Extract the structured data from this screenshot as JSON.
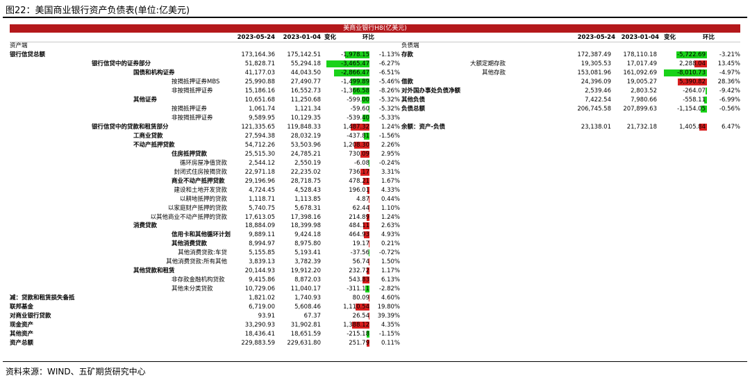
{
  "figure_title": "图22：美国商业银行资产负债表(单位:亿美元)",
  "banner": "美商业银行H8(亿美元)",
  "source": "资料来源：WIND、五矿期货研究中心",
  "colors": {
    "banner": "#b4181b",
    "neg_bar": "#19d219",
    "pos_bar": "#d91f1f"
  },
  "left": {
    "section": "资产端",
    "headers": {
      "d1": "2023-05-24",
      "d2": "2023-01-04",
      "chg": "变化",
      "pct": "环比"
    },
    "max_abs_change": 3465.47,
    "rows": [
      {
        "label": "银行信贷总额",
        "indent": 0,
        "bold": true,
        "d1": "173,164.36",
        "d2": "175,142.51",
        "chg": "-1,978.15",
        "cv": -1978.15,
        "pct": "-1.13%"
      },
      {
        "label": "银行信贷中的证券部分",
        "indent": 1,
        "bold": true,
        "d1": "51,828.71",
        "d2": "55,294.18",
        "chg": "-3,465.47",
        "cv": -3465.47,
        "pct": "-6.27%"
      },
      {
        "label": "国债和机构证券",
        "indent": 2,
        "bold": true,
        "d1": "41,177.03",
        "d2": "44,043.50",
        "chg": "-2,866.47",
        "cv": -2866.47,
        "pct": "-6.51%"
      },
      {
        "label": "按揭抵押证券MBS",
        "indent": 3,
        "bold": false,
        "d1": "25,990.88",
        "d2": "27,490.77",
        "chg": "-1,499.89",
        "cv": -1499.89,
        "pct": "-5.46%"
      },
      {
        "label": "非按揭抵押证券",
        "indent": 3,
        "bold": false,
        "d1": "15,186.16",
        "d2": "16,552.73",
        "chg": "-1,366.58",
        "cv": -1366.58,
        "pct": "-8.26%"
      },
      {
        "label": "其他证券",
        "indent": 2,
        "bold": true,
        "d1": "10,651.68",
        "d2": "11,250.68",
        "chg": "-599.00",
        "cv": -599.0,
        "pct": "-5.32%"
      },
      {
        "label": "按揭抵押证券",
        "indent": 3,
        "bold": false,
        "d1": "1,061.74",
        "d2": "1,121.34",
        "chg": "-59.60",
        "cv": -59.6,
        "pct": "-5.32%"
      },
      {
        "label": "非按揭抵押证券",
        "indent": 3,
        "bold": false,
        "d1": "9,589.95",
        "d2": "10,129.35",
        "chg": "-539.40",
        "cv": -539.4,
        "pct": "-5.33%"
      },
      {
        "label": "银行信贷中的贷款和租赁部分",
        "indent": 1,
        "bold": true,
        "d1": "121,335.65",
        "d2": "119,848.33",
        "chg": "1,487.32",
        "cv": 1487.32,
        "pct": "1.24%"
      },
      {
        "label": "工商业贷款",
        "indent": 2,
        "bold": true,
        "d1": "27,594.38",
        "d2": "28,032.19",
        "chg": "-437.81",
        "cv": -437.81,
        "pct": "-1.56%"
      },
      {
        "label": "不动产抵押贷款",
        "indent": 2,
        "bold": true,
        "d1": "54,712.26",
        "d2": "53,503.96",
        "chg": "1,208.30",
        "cv": 1208.3,
        "pct": "2.26%"
      },
      {
        "label": "住房抵押贷款",
        "indent": 3,
        "bold": true,
        "d1": "25,515.30",
        "d2": "24,785.21",
        "chg": "730.09",
        "cv": 730.09,
        "pct": "2.95%"
      },
      {
        "label": "循环房屋净值贷款",
        "indent": 4,
        "bold": false,
        "d1": "2,544.12",
        "d2": "2,550.19",
        "chg": "-6.08",
        "cv": -6.08,
        "pct": "-0.24%"
      },
      {
        "label": "封闭式住房按揭贷款",
        "indent": 4,
        "bold": false,
        "d1": "22,971.18",
        "d2": "22,235.02",
        "chg": "736.17",
        "cv": 736.17,
        "pct": "3.31%"
      },
      {
        "label": "商业不动产抵押贷款",
        "indent": 3,
        "bold": true,
        "d1": "29,196.96",
        "d2": "28,718.75",
        "chg": "478.21",
        "cv": 478.21,
        "pct": "1.67%"
      },
      {
        "label": "建设和土地开发贷款",
        "indent": 4,
        "bold": false,
        "d1": "4,724.45",
        "d2": "4,528.43",
        "chg": "196.01",
        "cv": 196.01,
        "pct": "4.33%"
      },
      {
        "label": "以耕地抵押的贷款",
        "indent": 4,
        "bold": false,
        "d1": "1,118.71",
        "d2": "1,113.85",
        "chg": "4.87",
        "cv": 4.87,
        "pct": "0.44%"
      },
      {
        "label": "以家庭财产抵押的贷款",
        "indent": 4,
        "bold": false,
        "d1": "5,740.75",
        "d2": "5,678.31",
        "chg": "62.44",
        "cv": 62.44,
        "pct": "1.10%"
      },
      {
        "label": "以其他商业不动产抵押的贷款",
        "indent": 4,
        "bold": false,
        "d1": "17,613.05",
        "d2": "17,398.16",
        "chg": "214.89",
        "cv": 214.89,
        "pct": "1.24%"
      },
      {
        "label": "消费贷款",
        "indent": 2,
        "bold": true,
        "d1": "18,884.09",
        "d2": "18,399.98",
        "chg": "484.11",
        "cv": 484.11,
        "pct": "2.63%"
      },
      {
        "label": "信用卡和其他循环计划",
        "indent": 3,
        "bold": true,
        "d1": "9,889.11",
        "d2": "9,424.18",
        "chg": "464.93",
        "cv": 464.93,
        "pct": "4.93%"
      },
      {
        "label": "其他消费贷款",
        "indent": 3,
        "bold": true,
        "d1": "8,994.97",
        "d2": "8,975.80",
        "chg": "19.17",
        "cv": 19.17,
        "pct": "0.21%"
      },
      {
        "label": "其他消费贷款:车贷",
        "indent": 4,
        "bold": false,
        "d1": "5,155.85",
        "d2": "5,193.41",
        "chg": "-37.56",
        "cv": -37.56,
        "pct": "-0.72%"
      },
      {
        "label": "其他消费贷款:所有其他",
        "indent": 4,
        "bold": false,
        "d1": "3,839.13",
        "d2": "3,782.39",
        "chg": "56.74",
        "cv": 56.74,
        "pct": "1.50%"
      },
      {
        "label": "其他贷款和租赁",
        "indent": 2,
        "bold": true,
        "d1": "20,144.93",
        "d2": "19,912.20",
        "chg": "232.72",
        "cv": 232.72,
        "pct": "1.17%"
      },
      {
        "label": "非存款金融机构贷款",
        "indent": 3,
        "bold": false,
        "d1": "9,415.86",
        "d2": "8,872.03",
        "chg": "543.83",
        "cv": 543.83,
        "pct": "6.13%"
      },
      {
        "label": "其他未分类贷款",
        "indent": 3,
        "bold": false,
        "d1": "10,729.06",
        "d2": "11,040.17",
        "chg": "-311.11",
        "cv": -311.11,
        "pct": "-2.82%"
      },
      {
        "label": "减：贷款和租赁损失备抵",
        "indent": 0,
        "bold": true,
        "d1": "1,821.02",
        "d2": "1,740.93",
        "chg": "80.09",
        "cv": 80.09,
        "pct": "4.60%"
      },
      {
        "label": "联邦基金",
        "indent": 0,
        "bold": true,
        "d1": "6,719.00",
        "d2": "5,608.46",
        "chg": "1,110.54",
        "cv": 1110.54,
        "pct": "19.80%"
      },
      {
        "label": "对商业银行贷款",
        "indent": 0,
        "bold": true,
        "d1": "93.91",
        "d2": "67.37",
        "chg": "26.54",
        "cv": 26.54,
        "pct": "39.39%"
      },
      {
        "label": "现金资产",
        "indent": 0,
        "bold": true,
        "d1": "33,290.93",
        "d2": "31,902.81",
        "chg": "1,388.12",
        "cv": 1388.12,
        "pct": "4.35%"
      },
      {
        "label": "其他资产",
        "indent": 0,
        "bold": true,
        "d1": "18,436.41",
        "d2": "18,651.59",
        "chg": "-215.18",
        "cv": -215.18,
        "pct": "-1.15%"
      },
      {
        "label": "资产总额",
        "indent": 0,
        "bold": true,
        "d1": "229,883.59",
        "d2": "229,631.80",
        "chg": "251.79",
        "cv": 251.79,
        "pct": "0.11%"
      }
    ]
  },
  "right": {
    "section": "负债端",
    "headers": {
      "d1": "2023-05-24",
      "d2": "2023-01-04",
      "chg": "变化",
      "pct": "环比"
    },
    "max_abs_change": 8010.73,
    "rows": [
      {
        "label": "存款",
        "align": "left",
        "bold": true,
        "d1": "172,387.49",
        "d2": "178,110.18",
        "chg": "-5,722.69",
        "cv": -5722.69,
        "pct": "-3.21%"
      },
      {
        "label": "大额定期存款",
        "align": "right",
        "bold": false,
        "d1": "19,305.53",
        "d2": "17,017.49",
        "chg": "2,288.04",
        "cv": 2288.04,
        "pct": "13.45%"
      },
      {
        "label": "其他存款",
        "align": "right",
        "bold": false,
        "d1": "153,081.96",
        "d2": "161,092.69",
        "chg": "-8,010.73",
        "cv": -8010.73,
        "pct": "-4.97%"
      },
      {
        "label": "借款",
        "align": "left",
        "bold": true,
        "d1": "24,396.09",
        "d2": "19,005.27",
        "chg": "5,390.82",
        "cv": 5390.82,
        "pct": "28.36%"
      },
      {
        "label": "对外国办事处负债净额",
        "align": "left",
        "bold": true,
        "d1": "2,539.46",
        "d2": "2,803.52",
        "chg": "-264.07",
        "cv": -264.07,
        "pct": "-9.42%"
      },
      {
        "label": "其他负债",
        "align": "left",
        "bold": true,
        "d1": "7,422.54",
        "d2": "7,980.66",
        "chg": "-558.11",
        "cv": -558.11,
        "pct": "-6.99%"
      },
      {
        "label": "负债总额",
        "align": "left",
        "bold": true,
        "d1": "206,745.58",
        "d2": "207,899.63",
        "chg": "-1,154.05",
        "cv": -1154.05,
        "pct": "-0.56%"
      },
      {
        "label": "",
        "align": "left",
        "bold": false,
        "d1": "",
        "d2": "",
        "chg": "",
        "cv": 0,
        "pct": ""
      },
      {
        "label": "余额：资产-负债",
        "align": "left",
        "bold": true,
        "d1": "23,138.01",
        "d2": "21,732.18",
        "chg": "1,405.84",
        "cv": 1405.84,
        "pct": "6.47%"
      }
    ]
  }
}
